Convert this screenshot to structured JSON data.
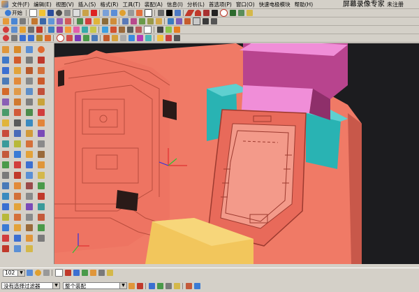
{
  "menubar": {
    "items": [
      "文件(F)",
      "编辑(E)",
      "视图(V)",
      "插入(S)",
      "格式(R)",
      "工具(T)",
      "装配(A)",
      "信息(I)",
      "分析(L)",
      "首选项(P)",
      "窗口(O)",
      "快速电极模块",
      "帮助(H)"
    ],
    "title": "屏幕录像专家",
    "title_suffix": "未注册"
  },
  "toolbar": {
    "start_label": "开始",
    "zoom_value": "102"
  },
  "selection": {
    "filter_label": "没有选择过滤器",
    "scope_label": "整个装配"
  },
  "colors": {
    "part_body": "#f07a66",
    "part_body_dark": "#c8584a",
    "slide_pink": "#f08ed8",
    "slide_magenta": "#b8448e",
    "cyan_block": "#29b3b3",
    "yellow_block": "#f2c65c",
    "background": "#1c1c1f"
  }
}
